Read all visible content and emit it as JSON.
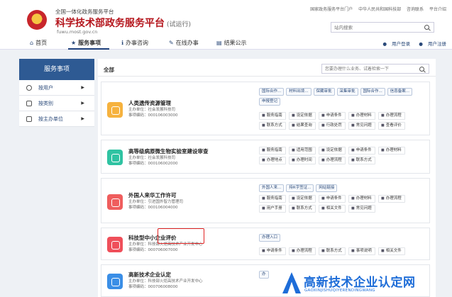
{
  "header": {
    "site_top": "全国一体化政务服务平台",
    "site_title": "科学技术部政务服务平台",
    "site_title_note": "(试运行)",
    "site_url": "fuwu.most.gov.cn",
    "top_links": [
      "国家政务服务平台门户",
      "中华人民共和国科技部",
      "咨询联系",
      "平台介绍"
    ],
    "search_placeholder": "站内搜索"
  },
  "nav": {
    "items": [
      {
        "label": "首页",
        "icon": "home-icon"
      },
      {
        "label": "服务事项",
        "icon": "star-icon"
      },
      {
        "label": "办事咨询",
        "icon": "info-icon"
      },
      {
        "label": "在线办事",
        "icon": "pencil-icon"
      },
      {
        "label": "结果公示",
        "icon": "document-icon"
      }
    ],
    "login": "用户登录",
    "register": "用户注册"
  },
  "sidebar": {
    "title": "服务事项",
    "items": [
      "按用户",
      "按类别",
      "按主办单位"
    ]
  },
  "main": {
    "tab": "全部",
    "search_placeholder": "您要办理什么业务、试着检索一下",
    "cards": [
      {
        "title": "人类遗传资源管理",
        "host": "主办单位：社会发展科技司",
        "code": "事项编码：000106003000",
        "color": "#f6b23e",
        "pills": [
          "国际合作...",
          "材料出境...",
          "保藏审批",
          "采集审批",
          "国际合作...",
          "信息备案...",
          "申报登记"
        ],
        "links": [
          "服务指南",
          "设定依据",
          "申请条件",
          "办理材料",
          "办理流程",
          "联系方式",
          "结果查询",
          "行政处罚",
          "常见问题",
          "查看评价"
        ]
      },
      {
        "title": "高等级病原微生物实验室建设审查",
        "host": "主办单位：社会发展科技司",
        "code": "事项编码：000106002000",
        "color": "#2fc3a2",
        "pills": [],
        "links": [
          "服务指南",
          "适用范围",
          "设定依据",
          "申请条件",
          "办理材料",
          "办理地点",
          "办理时间",
          "办理流程",
          "联系方式"
        ]
      },
      {
        "title": "外国人来华工作许可",
        "host": "主办单位：引进国外智力管理司",
        "code": "事项编码：000106004000",
        "color": "#ef5d5d",
        "pills": [
          "外国人来...",
          "持R字签证...",
          "网站链接"
        ],
        "links": [
          "服务指南",
          "设定依据",
          "申请条件",
          "办理材料",
          "办理流程",
          "用户手册",
          "联系方式",
          "相关文件",
          "常见问题"
        ]
      },
      {
        "title": "科技型中小企业评价",
        "host": "主办单位：科技部火炬高技术产业开发中心",
        "code": "事项编码：000706007000",
        "color": "#ef4f5a",
        "pills": [
          "办理入口"
        ],
        "links": [
          "申请条件",
          "办理流程",
          "联系方式",
          "事项说明",
          "相关文件"
        ]
      },
      {
        "title": "高新技术企业认定",
        "host": "主办单位：科技部火炬高技术产业开发中心",
        "code": "事项编码：000706008000",
        "color": "#3a8ee6",
        "pills": [
          "办"
        ],
        "links": []
      }
    ]
  },
  "watermark": {
    "cn": "高新技术企业认定网",
    "en": "GAOXINJISHUQIYERENDINGWANG"
  }
}
